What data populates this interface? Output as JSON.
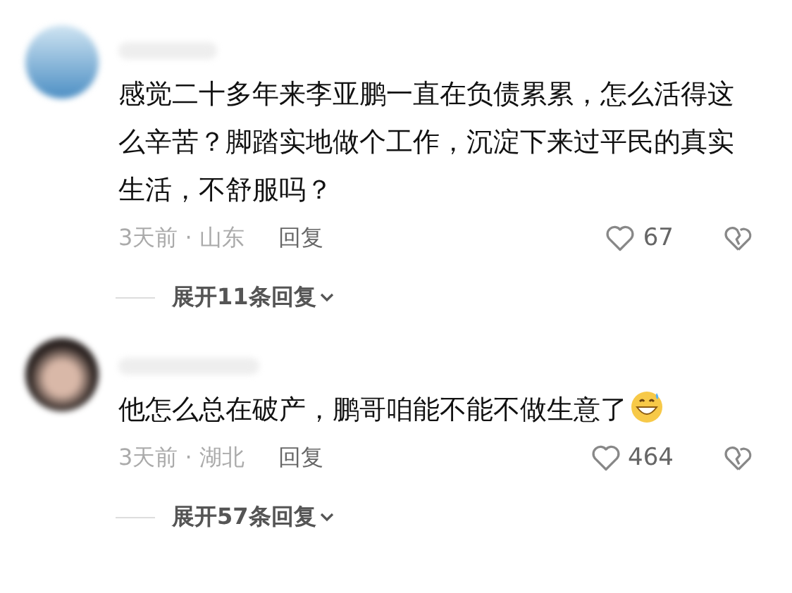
{
  "comments": [
    {
      "kind": "landscape",
      "text": "感觉二十多年来李亚鹏一直在负债累累，怎么活得这么辛苦？脚踏实地做个工作，沉淀下来过平民的真实生活，不舒服吗？",
      "emoji": false,
      "time": "3天前 · 山东",
      "reply": "回复",
      "likes": "67",
      "liked": false,
      "disliked": false,
      "expand": "展开11条回复"
    },
    {
      "kind": "person",
      "text": "他怎么总在破产，鹏哥咱能不能不做生意了",
      "emoji": true,
      "time": "3天前 · 湖北",
      "reply": "回复",
      "likes": "464",
      "liked": false,
      "disliked": false,
      "expand": "展开57条回复"
    }
  ]
}
